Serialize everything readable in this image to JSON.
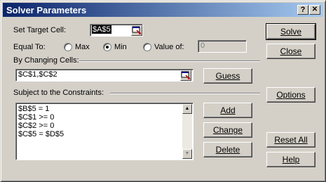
{
  "window": {
    "title": "Solver Parameters",
    "help_btn": "?",
    "close_btn": "✕"
  },
  "target": {
    "label": "Set Target Cell:",
    "value": "$A$5"
  },
  "equal_to": {
    "label": "Equal To:",
    "options": [
      {
        "label": "Max",
        "checked": false
      },
      {
        "label": "Min",
        "checked": true
      },
      {
        "label": "Value of:",
        "checked": false
      }
    ],
    "value_of": "0"
  },
  "changing": {
    "label": "By Changing Cells:",
    "value": "$C$1,$C$2",
    "guess_label": "Guess"
  },
  "constraints": {
    "label": "Subject to the Constraints:",
    "items": [
      "$B$5 = 1",
      "$C$1 >= 0",
      "$C$2 >= 0",
      "$C$5 = $D$5"
    ],
    "add_label": "Add",
    "change_label": "Change",
    "delete_label": "Delete"
  },
  "side_buttons": {
    "solve": "Solve",
    "close": "Close",
    "options": "Options",
    "reset_all": "Reset All",
    "help": "Help"
  }
}
